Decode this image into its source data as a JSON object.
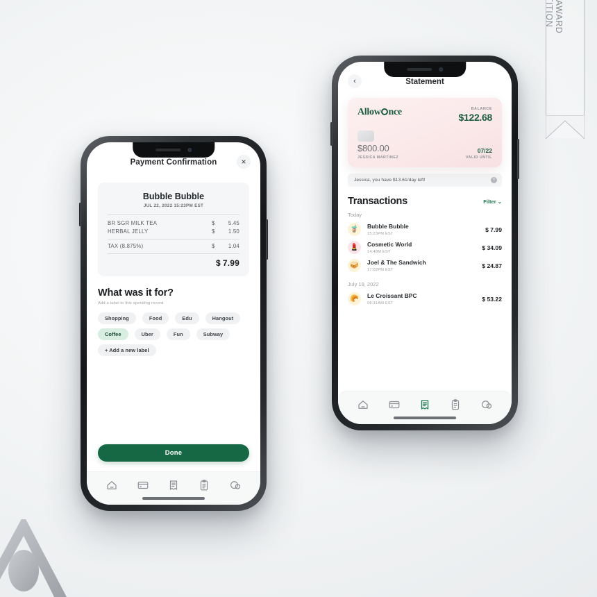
{
  "award_ribbon": {
    "line1": "A'DESIGN AWARD",
    "line2": "& COMPETITION"
  },
  "left_phone": {
    "header": {
      "title": "Payment Confirmation",
      "close_icon": "×"
    },
    "receipt": {
      "merchant": "Bubble Bubble",
      "date": "JUL 22, 2022 15:23PM EST",
      "items": [
        {
          "name": "BR SGR MILK TEA",
          "currency": "$",
          "amount": "5.45"
        },
        {
          "name": "HERBAL JELLY",
          "currency": "$",
          "amount": "1.50"
        }
      ],
      "tax": {
        "name": "TAX (8.875%)",
        "currency": "$",
        "amount": "1.04"
      },
      "total": {
        "currency": "$",
        "amount": "7.99"
      }
    },
    "label_section": {
      "title": "What was it for?",
      "subtitle": "Add a label to this spending record",
      "chips": [
        {
          "label": "Shopping",
          "selected": false
        },
        {
          "label": "Food",
          "selected": false
        },
        {
          "label": "Edu",
          "selected": false
        },
        {
          "label": "Hangout",
          "selected": false
        },
        {
          "label": "Coffee",
          "selected": true
        },
        {
          "label": "Uber",
          "selected": false
        },
        {
          "label": "Fun",
          "selected": false
        },
        {
          "label": "Subway",
          "selected": false
        }
      ],
      "add_label": "+ Add a new label"
    },
    "done_button": "Done",
    "tabbar": {
      "items": [
        {
          "icon": "home-icon",
          "active": false
        },
        {
          "icon": "card-icon",
          "active": false
        },
        {
          "icon": "receipt-icon",
          "active": false
        },
        {
          "icon": "clipboard-icon",
          "active": false
        },
        {
          "icon": "chat-icon",
          "active": false
        }
      ]
    }
  },
  "right_phone": {
    "header": {
      "back_icon": "‹",
      "title": "Statement"
    },
    "card": {
      "brand_prefix": "Allow",
      "brand_suffix": "nce",
      "balance_label": "BALANCE",
      "balance_value": "$122.68",
      "limit_amount": "$800.00",
      "holder_name": "JESSICA MARTINEZ",
      "valid_date": "07/22",
      "valid_label": "VALID UNTIL"
    },
    "notice": {
      "text": "Jessica, you have $13.61/day left!",
      "close_icon": "×"
    },
    "transactions": {
      "title": "Transactions",
      "filter_label": "Filter ⌄",
      "groups": [
        {
          "day": "Today",
          "rows": [
            {
              "icon": "🧋",
              "icon_bg": "#fdf4d8",
              "name": "Bubble Bubble",
              "time": "15:23PM EST",
              "amount": "$ 7.99"
            },
            {
              "icon": "💄",
              "icon_bg": "#fbe4e8",
              "name": "Cosmetic World",
              "time": "14:48M EST",
              "amount": "$ 34.09"
            },
            {
              "icon": "🥪",
              "icon_bg": "#fdf4d8",
              "name": "Joel & The Sandwich",
              "time": "17:02PM EST",
              "amount": "$ 24.87"
            }
          ]
        },
        {
          "day": "July 19, 2022",
          "rows": [
            {
              "icon": "🥐",
              "icon_bg": "#fdf4d8",
              "name": "Le Croissant BPC",
              "time": "08:31AM EST",
              "amount": "$ 53.22"
            }
          ]
        }
      ]
    },
    "tabbar": {
      "items": [
        {
          "icon": "home-icon",
          "active": false
        },
        {
          "icon": "card-icon",
          "active": false
        },
        {
          "icon": "receipt-icon",
          "active": true
        },
        {
          "icon": "clipboard-icon",
          "active": false
        },
        {
          "icon": "chat-icon",
          "active": false
        }
      ]
    }
  },
  "colors": {
    "brand_green": "#166845",
    "accent_green": "#1f7a52",
    "card_pink": "#fbe9ea",
    "chip_selected": "#d7eee1",
    "background": "#eff1f3"
  }
}
